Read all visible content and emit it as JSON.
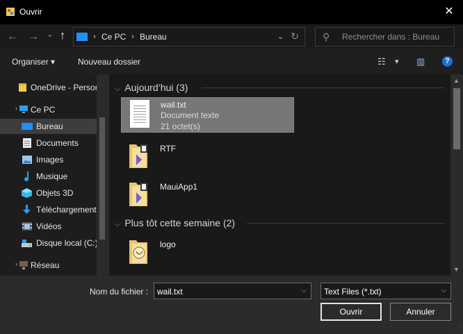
{
  "window": {
    "title": "Ouvrir",
    "close_label": "✕"
  },
  "nav": {
    "back_icon": "←",
    "forward_icon": "→",
    "recent_icon": "⌄",
    "up_icon": "↑",
    "breadcrumb": [
      "Ce PC",
      "Bureau"
    ],
    "breadcrumb_sep": "›",
    "address_dropdown": "⌄",
    "refresh_icon": "↻",
    "search_placeholder": "Rechercher dans : Bureau"
  },
  "toolbar": {
    "organise_label": "Organiser ▾",
    "new_folder_label": "Nouveau dossier",
    "view_icon": "☷",
    "view_dropdown": "▾",
    "pane_icon": "▥",
    "help_icon": "?"
  },
  "sidebar": {
    "items": [
      {
        "label": "OneDrive - Person",
        "icon": "onedrive-icon"
      },
      {
        "label": "Ce PC",
        "icon": "computer-icon"
      },
      {
        "label": "Bureau",
        "icon": "desktop-icon",
        "selected": true
      },
      {
        "label": "Documents",
        "icon": "documents-icon"
      },
      {
        "label": "Images",
        "icon": "images-icon"
      },
      {
        "label": "Musique",
        "icon": "music-icon"
      },
      {
        "label": "Objets 3D",
        "icon": "objects3d-icon"
      },
      {
        "label": "Téléchargements",
        "icon": "downloads-icon"
      },
      {
        "label": "Vidéos",
        "icon": "videos-icon"
      },
      {
        "label": "Disque local (C:)",
        "icon": "drive-icon"
      },
      {
        "label": "Réseau",
        "icon": "network-icon"
      }
    ]
  },
  "main": {
    "groups": [
      {
        "header": "Aujourd’hui (3)",
        "files": [
          {
            "name": "wail.txt",
            "type": "Document texte",
            "size": "21 octet(s)",
            "selected": true
          },
          {
            "name": "RTF"
          },
          {
            "name": "MauiApp1"
          }
        ]
      },
      {
        "header": "Plus tôt cette semaine (2)",
        "files": [
          {
            "name": "logo"
          }
        ]
      }
    ]
  },
  "bottom": {
    "filename_label": "Nom du fichier :",
    "filename_value": "wail.txt",
    "filetype_value": "Text Files (*.txt)",
    "open_label": "Ouvrir",
    "cancel_label": "Annuler"
  },
  "colors": {
    "accent": "#1e6fd6",
    "selection": "#777777",
    "background": "#191919"
  }
}
